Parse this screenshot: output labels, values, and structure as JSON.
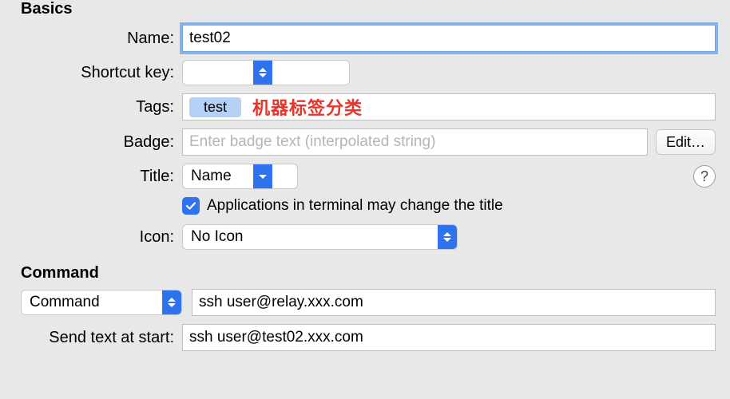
{
  "sections": {
    "basics": "Basics",
    "command": "Command"
  },
  "labels": {
    "name": "Name:",
    "shortcut_key": "Shortcut key:",
    "tags": "Tags:",
    "badge": "Badge:",
    "title": "Title:",
    "icon": "Icon:",
    "send_text_at_start": "Send text at start:",
    "edit_button": "Edit…",
    "help": "?"
  },
  "name": {
    "value": "test02"
  },
  "shortcut": {
    "value": ""
  },
  "tags": {
    "items": [
      "test"
    ],
    "annotation": "机器标签分类"
  },
  "badge": {
    "value": "",
    "placeholder": "Enter badge text (interpolated string)"
  },
  "title": {
    "selected": "Name"
  },
  "title_checkbox": {
    "checked": true,
    "label": "Applications in terminal may change the title"
  },
  "icon": {
    "selected": "No Icon"
  },
  "command": {
    "mode": "Command",
    "value": "ssh user@relay.xxx.com"
  },
  "send_text": {
    "value": "ssh user@test02.xxx.com"
  }
}
